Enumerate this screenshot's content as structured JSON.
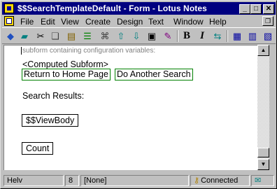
{
  "window": {
    "title": "$$SearchTemplateDefault - Form - Lotus Notes",
    "minimize_glyph": "_",
    "maximize_glyph": "□",
    "close_glyph": "✕",
    "restore_glyph": "❐"
  },
  "menu": {
    "items": [
      "File",
      "Edit",
      "View",
      "Create",
      "Design",
      "Text",
      "Window",
      "Help"
    ]
  },
  "toolbar": {
    "icons": [
      "smarticon-diamond-icon",
      "save-icon",
      "cut-icon",
      "copy-icon",
      "paste-icon",
      "navigator-icon",
      "attach-icon",
      "move-up-icon",
      "move-down-icon",
      "stack-icon",
      "spell-check-icon",
      "bold-icon",
      "italic-icon",
      "refresh-icon",
      "properties-icon",
      "layout-icon",
      "hide-icon"
    ],
    "bold_label": "B",
    "italic_label": "I"
  },
  "document": {
    "hint": "subform containing configuration variables:",
    "computed_subform": "<Computed Subform>",
    "return_home": "Return to Home Page",
    "another_search": "Do Another Search",
    "results_label": "Search Results:",
    "viewbody": "$$ViewBody",
    "count": "Count"
  },
  "scrollbar": {
    "up_glyph": "▲",
    "down_glyph": "▼"
  },
  "status": {
    "font": "Helv",
    "size": "8",
    "style": "[None]",
    "connection": "Connected"
  },
  "colors": {
    "titlebar": "#000080",
    "hotspot_border": "#008000",
    "hint_text": "#808080"
  }
}
